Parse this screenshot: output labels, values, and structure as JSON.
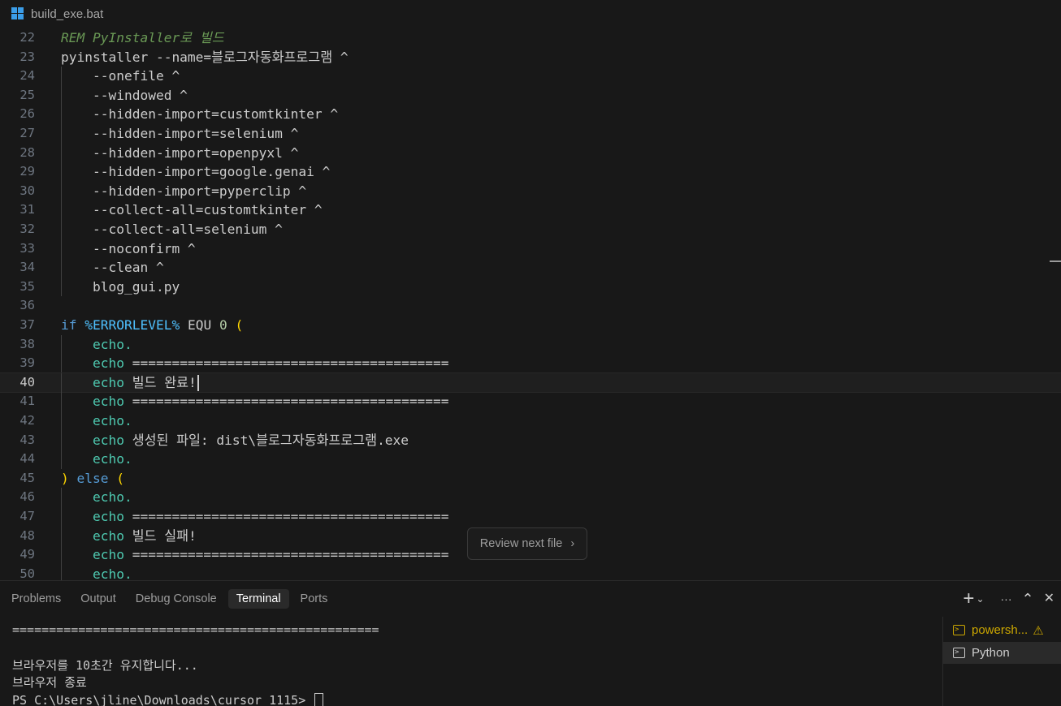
{
  "breadcrumb": {
    "file_icon": "windows-batch-icon",
    "file_name": "build_exe.bat"
  },
  "editor": {
    "current_line": 40,
    "lines": [
      {
        "n": "22",
        "seg": [
          [
            "rem",
            "REM PyInstaller로 빌드"
          ]
        ]
      },
      {
        "n": "23",
        "seg": [
          [
            "plain",
            "pyinstaller --name=블로그자동화프로그램 ^"
          ]
        ]
      },
      {
        "n": "24",
        "seg": [
          [
            "plain",
            "    --onefile ^"
          ]
        ]
      },
      {
        "n": "25",
        "seg": [
          [
            "plain",
            "    --windowed ^"
          ]
        ]
      },
      {
        "n": "26",
        "seg": [
          [
            "plain",
            "    --hidden-import=customtkinter ^"
          ]
        ]
      },
      {
        "n": "27",
        "seg": [
          [
            "plain",
            "    --hidden-import=selenium ^"
          ]
        ]
      },
      {
        "n": "28",
        "seg": [
          [
            "plain",
            "    --hidden-import=openpyxl ^"
          ]
        ]
      },
      {
        "n": "29",
        "seg": [
          [
            "plain",
            "    --hidden-import=google.genai ^"
          ]
        ]
      },
      {
        "n": "30",
        "seg": [
          [
            "plain",
            "    --hidden-import=pyperclip ^"
          ]
        ]
      },
      {
        "n": "31",
        "seg": [
          [
            "plain",
            "    --collect-all=customtkinter ^"
          ]
        ]
      },
      {
        "n": "32",
        "seg": [
          [
            "plain",
            "    --collect-all=selenium ^"
          ]
        ]
      },
      {
        "n": "33",
        "seg": [
          [
            "plain",
            "    --noconfirm ^"
          ]
        ]
      },
      {
        "n": "34",
        "seg": [
          [
            "plain",
            "    --clean ^"
          ]
        ]
      },
      {
        "n": "35",
        "seg": [
          [
            "plain",
            "    blog_gui.py"
          ]
        ]
      },
      {
        "n": "36",
        "seg": []
      },
      {
        "n": "37",
        "seg": [
          [
            "kw",
            "if "
          ],
          [
            "var",
            "%ERRORLEVEL%"
          ],
          [
            "plain",
            " EQU "
          ],
          [
            "num",
            "0"
          ],
          [
            "plain",
            " "
          ],
          [
            "par",
            "("
          ]
        ]
      },
      {
        "n": "38",
        "seg": [
          [
            "plain",
            "    "
          ],
          [
            "echo",
            "echo."
          ]
        ]
      },
      {
        "n": "39",
        "seg": [
          [
            "plain",
            "    "
          ],
          [
            "echo",
            "echo"
          ],
          [
            "plain",
            " ========================================"
          ]
        ]
      },
      {
        "n": "40",
        "seg": [
          [
            "plain",
            "    "
          ],
          [
            "echo",
            "echo"
          ],
          [
            "plain",
            " 빌드 완료!"
          ]
        ]
      },
      {
        "n": "41",
        "seg": [
          [
            "plain",
            "    "
          ],
          [
            "echo",
            "echo"
          ],
          [
            "plain",
            " ========================================"
          ]
        ]
      },
      {
        "n": "42",
        "seg": [
          [
            "plain",
            "    "
          ],
          [
            "echo",
            "echo."
          ]
        ]
      },
      {
        "n": "43",
        "seg": [
          [
            "plain",
            "    "
          ],
          [
            "echo",
            "echo"
          ],
          [
            "plain",
            " 생성된 파일: dist\\블로그자동화프로그램.exe"
          ]
        ]
      },
      {
        "n": "44",
        "seg": [
          [
            "plain",
            "    "
          ],
          [
            "echo",
            "echo."
          ]
        ]
      },
      {
        "n": "45",
        "seg": [
          [
            "par",
            ")"
          ],
          [
            "kw",
            " else "
          ],
          [
            "par",
            "("
          ]
        ]
      },
      {
        "n": "46",
        "seg": [
          [
            "plain",
            "    "
          ],
          [
            "echo",
            "echo."
          ]
        ]
      },
      {
        "n": "47",
        "seg": [
          [
            "plain",
            "    "
          ],
          [
            "echo",
            "echo"
          ],
          [
            "plain",
            " ========================================"
          ]
        ]
      },
      {
        "n": "48",
        "seg": [
          [
            "plain",
            "    "
          ],
          [
            "echo",
            "echo"
          ],
          [
            "plain",
            " 빌드 실패!"
          ]
        ]
      },
      {
        "n": "49",
        "seg": [
          [
            "plain",
            "    "
          ],
          [
            "echo",
            "echo"
          ],
          [
            "plain",
            " ========================================"
          ]
        ]
      },
      {
        "n": "50",
        "seg": [
          [
            "plain",
            "    "
          ],
          [
            "echo",
            "echo."
          ]
        ]
      }
    ]
  },
  "review_button": {
    "label": "Review next file",
    "icon": "chevron-right-icon",
    "arrow": "›"
  },
  "panel": {
    "tabs": [
      {
        "label": "Problems",
        "active": false
      },
      {
        "label": "Output",
        "active": false
      },
      {
        "label": "Debug Console",
        "active": false
      },
      {
        "label": "Terminal",
        "active": true
      },
      {
        "label": "Ports",
        "active": false
      }
    ],
    "actions": {
      "new_terminal": "+",
      "dropdown": "⌄",
      "more": "···",
      "maximize": "⌃",
      "close": "✕"
    }
  },
  "terminal": {
    "lines": [
      "==================================================",
      "",
      "브라우저를 10초간 유지합니다...",
      "브라우저 종료",
      "PS C:\\Users\\jline\\Downloads\\cursor_1115> "
    ],
    "instances": [
      {
        "label": "powersh...",
        "icon": "powershell-icon",
        "warning": true,
        "warning_glyph": "⚠"
      },
      {
        "label": "Python",
        "icon": "terminal-icon",
        "warning": false,
        "selected": true
      }
    ]
  },
  "colors": {
    "background": "#181818",
    "comment": "#6a9955",
    "keyword": "#569cd6",
    "variable": "#4fc1ff",
    "echo": "#4ec9b0",
    "bracket": "#ffd700",
    "warning": "#cca700"
  }
}
